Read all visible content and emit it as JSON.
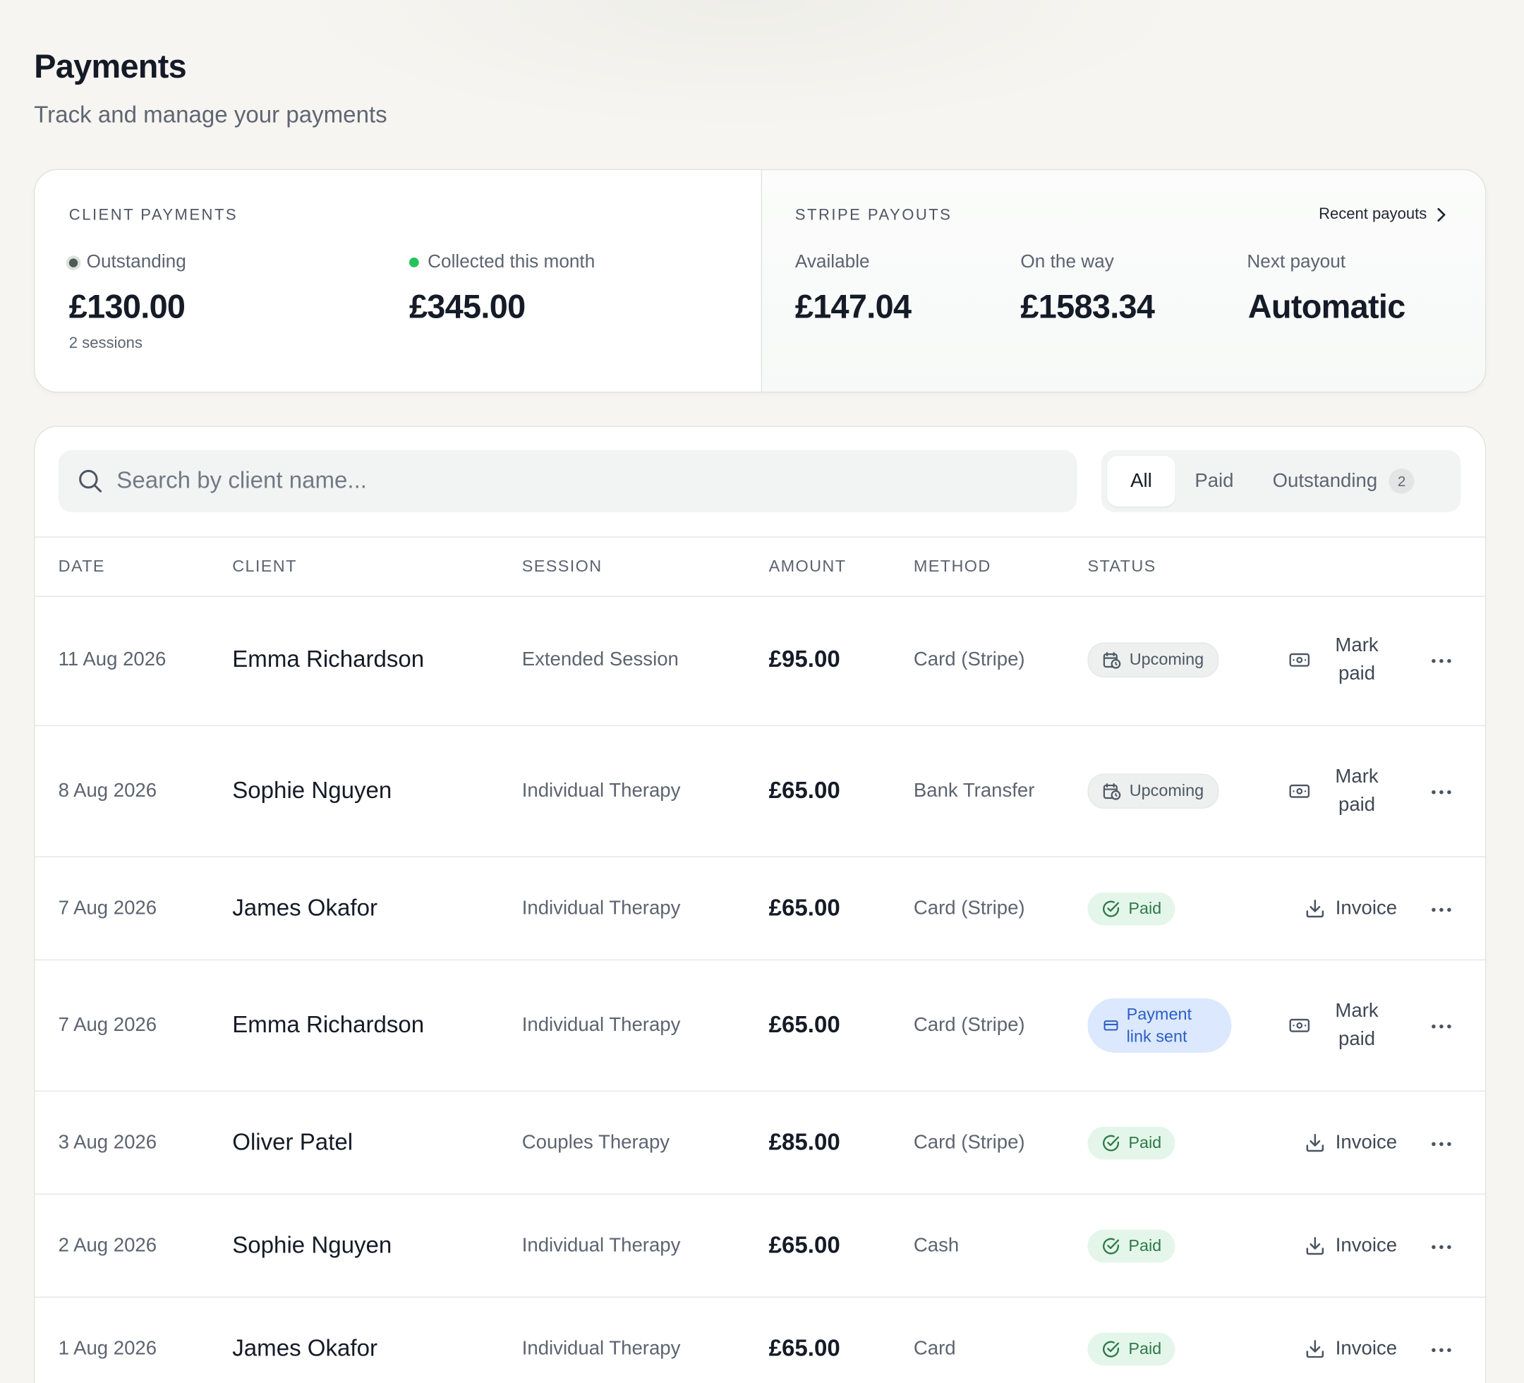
{
  "header": {
    "title": "Payments",
    "subtitle": "Track and manage your payments"
  },
  "client_payments": {
    "label": "CLIENT PAYMENTS",
    "outstanding_label": "Outstanding",
    "outstanding_value": "£130.00",
    "outstanding_sub": "2 sessions",
    "collected_label": "Collected this month",
    "collected_value": "£345.00"
  },
  "stripe_payouts": {
    "label": "STRIPE PAYOUTS",
    "recent_link": "Recent payouts",
    "available_label": "Available",
    "available_value": "£147.04",
    "on_way_label": "On the way",
    "on_way_value": "£1583.34",
    "next_label": "Next payout",
    "next_value": "Automatic"
  },
  "search": {
    "placeholder": "Search by client name..."
  },
  "filters": {
    "all": "All",
    "paid": "Paid",
    "outstanding": "Outstanding",
    "outstanding_count": "2",
    "active": "All"
  },
  "table": {
    "columns": {
      "date": "DATE",
      "client": "CLIENT",
      "session": "SESSION",
      "amount": "AMOUNT",
      "method": "METHOD",
      "status": "STATUS"
    },
    "rows": [
      {
        "date": "11 Aug 2026",
        "client": "Emma Richardson",
        "session": "Extended Session",
        "amount": "£95.00",
        "method": "Card (Stripe)",
        "status": "Upcoming",
        "action": "Mark paid"
      },
      {
        "date": "8 Aug 2026",
        "client": "Sophie Nguyen",
        "session": "Individual Therapy",
        "amount": "£65.00",
        "method": "Bank Transfer",
        "status": "Upcoming",
        "action": "Mark paid"
      },
      {
        "date": "7 Aug 2026",
        "client": "James Okafor",
        "session": "Individual Therapy",
        "amount": "£65.00",
        "method": "Card (Stripe)",
        "status": "Paid",
        "action": "Invoice"
      },
      {
        "date": "7 Aug 2026",
        "client": "Emma Richardson",
        "session": "Individual Therapy",
        "amount": "£65.00",
        "method": "Card (Stripe)",
        "status": "Payment link sent",
        "action": "Mark paid"
      },
      {
        "date": "3 Aug 2026",
        "client": "Oliver Patel",
        "session": "Couples Therapy",
        "amount": "£85.00",
        "method": "Card (Stripe)",
        "status": "Paid",
        "action": "Invoice"
      },
      {
        "date": "2 Aug 2026",
        "client": "Sophie Nguyen",
        "session": "Individual Therapy",
        "amount": "£65.00",
        "method": "Cash",
        "status": "Paid",
        "action": "Invoice"
      },
      {
        "date": "1 Aug 2026",
        "client": "James Okafor",
        "session": "Individual Therapy",
        "amount": "£65.00",
        "method": "Card",
        "status": "Paid",
        "action": "Invoice"
      }
    ]
  },
  "colors": {
    "paid_badge_bg": "#e4f6ea",
    "paid_badge_text": "#2f7a49",
    "link_badge_bg": "#dbe8fd",
    "link_badge_text": "#2d5ec8",
    "collected_dot": "#25c45a"
  },
  "icons": {
    "search": "search-icon",
    "chevron": "chevron-right-icon",
    "upcoming": "calendar-clock-icon",
    "paid": "check-circle-icon",
    "link": "credit-card-icon",
    "mark_paid": "banknote-icon",
    "invoice": "download-icon",
    "more": "more-horizontal-icon"
  }
}
